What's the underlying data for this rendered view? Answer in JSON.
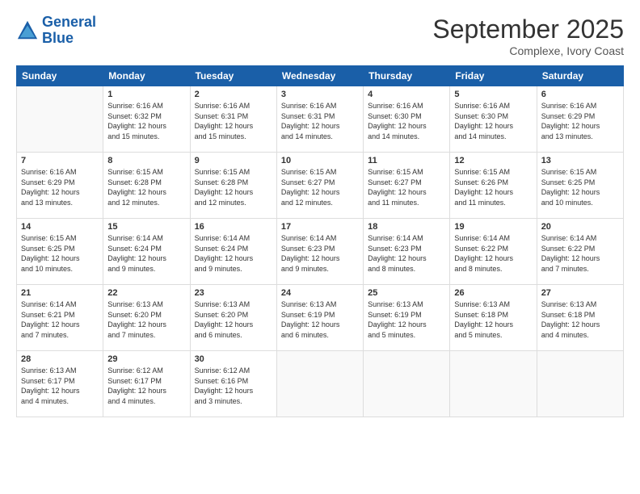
{
  "header": {
    "logo_line1": "General",
    "logo_line2": "Blue",
    "month_title": "September 2025",
    "subtitle": "Complexe, Ivory Coast"
  },
  "weekdays": [
    "Sunday",
    "Monday",
    "Tuesday",
    "Wednesday",
    "Thursday",
    "Friday",
    "Saturday"
  ],
  "weeks": [
    [
      {
        "day": "",
        "info": ""
      },
      {
        "day": "1",
        "info": "Sunrise: 6:16 AM\nSunset: 6:32 PM\nDaylight: 12 hours\nand 15 minutes."
      },
      {
        "day": "2",
        "info": "Sunrise: 6:16 AM\nSunset: 6:31 PM\nDaylight: 12 hours\nand 15 minutes."
      },
      {
        "day": "3",
        "info": "Sunrise: 6:16 AM\nSunset: 6:31 PM\nDaylight: 12 hours\nand 14 minutes."
      },
      {
        "day": "4",
        "info": "Sunrise: 6:16 AM\nSunset: 6:30 PM\nDaylight: 12 hours\nand 14 minutes."
      },
      {
        "day": "5",
        "info": "Sunrise: 6:16 AM\nSunset: 6:30 PM\nDaylight: 12 hours\nand 14 minutes."
      },
      {
        "day": "6",
        "info": "Sunrise: 6:16 AM\nSunset: 6:29 PM\nDaylight: 12 hours\nand 13 minutes."
      }
    ],
    [
      {
        "day": "7",
        "info": "Sunrise: 6:16 AM\nSunset: 6:29 PM\nDaylight: 12 hours\nand 13 minutes."
      },
      {
        "day": "8",
        "info": "Sunrise: 6:15 AM\nSunset: 6:28 PM\nDaylight: 12 hours\nand 12 minutes."
      },
      {
        "day": "9",
        "info": "Sunrise: 6:15 AM\nSunset: 6:28 PM\nDaylight: 12 hours\nand 12 minutes."
      },
      {
        "day": "10",
        "info": "Sunrise: 6:15 AM\nSunset: 6:27 PM\nDaylight: 12 hours\nand 12 minutes."
      },
      {
        "day": "11",
        "info": "Sunrise: 6:15 AM\nSunset: 6:27 PM\nDaylight: 12 hours\nand 11 minutes."
      },
      {
        "day": "12",
        "info": "Sunrise: 6:15 AM\nSunset: 6:26 PM\nDaylight: 12 hours\nand 11 minutes."
      },
      {
        "day": "13",
        "info": "Sunrise: 6:15 AM\nSunset: 6:25 PM\nDaylight: 12 hours\nand 10 minutes."
      }
    ],
    [
      {
        "day": "14",
        "info": "Sunrise: 6:15 AM\nSunset: 6:25 PM\nDaylight: 12 hours\nand 10 minutes."
      },
      {
        "day": "15",
        "info": "Sunrise: 6:14 AM\nSunset: 6:24 PM\nDaylight: 12 hours\nand 9 minutes."
      },
      {
        "day": "16",
        "info": "Sunrise: 6:14 AM\nSunset: 6:24 PM\nDaylight: 12 hours\nand 9 minutes."
      },
      {
        "day": "17",
        "info": "Sunrise: 6:14 AM\nSunset: 6:23 PM\nDaylight: 12 hours\nand 9 minutes."
      },
      {
        "day": "18",
        "info": "Sunrise: 6:14 AM\nSunset: 6:23 PM\nDaylight: 12 hours\nand 8 minutes."
      },
      {
        "day": "19",
        "info": "Sunrise: 6:14 AM\nSunset: 6:22 PM\nDaylight: 12 hours\nand 8 minutes."
      },
      {
        "day": "20",
        "info": "Sunrise: 6:14 AM\nSunset: 6:22 PM\nDaylight: 12 hours\nand 7 minutes."
      }
    ],
    [
      {
        "day": "21",
        "info": "Sunrise: 6:14 AM\nSunset: 6:21 PM\nDaylight: 12 hours\nand 7 minutes."
      },
      {
        "day": "22",
        "info": "Sunrise: 6:13 AM\nSunset: 6:20 PM\nDaylight: 12 hours\nand 7 minutes."
      },
      {
        "day": "23",
        "info": "Sunrise: 6:13 AM\nSunset: 6:20 PM\nDaylight: 12 hours\nand 6 minutes."
      },
      {
        "day": "24",
        "info": "Sunrise: 6:13 AM\nSunset: 6:19 PM\nDaylight: 12 hours\nand 6 minutes."
      },
      {
        "day": "25",
        "info": "Sunrise: 6:13 AM\nSunset: 6:19 PM\nDaylight: 12 hours\nand 5 minutes."
      },
      {
        "day": "26",
        "info": "Sunrise: 6:13 AM\nSunset: 6:18 PM\nDaylight: 12 hours\nand 5 minutes."
      },
      {
        "day": "27",
        "info": "Sunrise: 6:13 AM\nSunset: 6:18 PM\nDaylight: 12 hours\nand 4 minutes."
      }
    ],
    [
      {
        "day": "28",
        "info": "Sunrise: 6:13 AM\nSunset: 6:17 PM\nDaylight: 12 hours\nand 4 minutes."
      },
      {
        "day": "29",
        "info": "Sunrise: 6:12 AM\nSunset: 6:17 PM\nDaylight: 12 hours\nand 4 minutes."
      },
      {
        "day": "30",
        "info": "Sunrise: 6:12 AM\nSunset: 6:16 PM\nDaylight: 12 hours\nand 3 minutes."
      },
      {
        "day": "",
        "info": ""
      },
      {
        "day": "",
        "info": ""
      },
      {
        "day": "",
        "info": ""
      },
      {
        "day": "",
        "info": ""
      }
    ]
  ]
}
